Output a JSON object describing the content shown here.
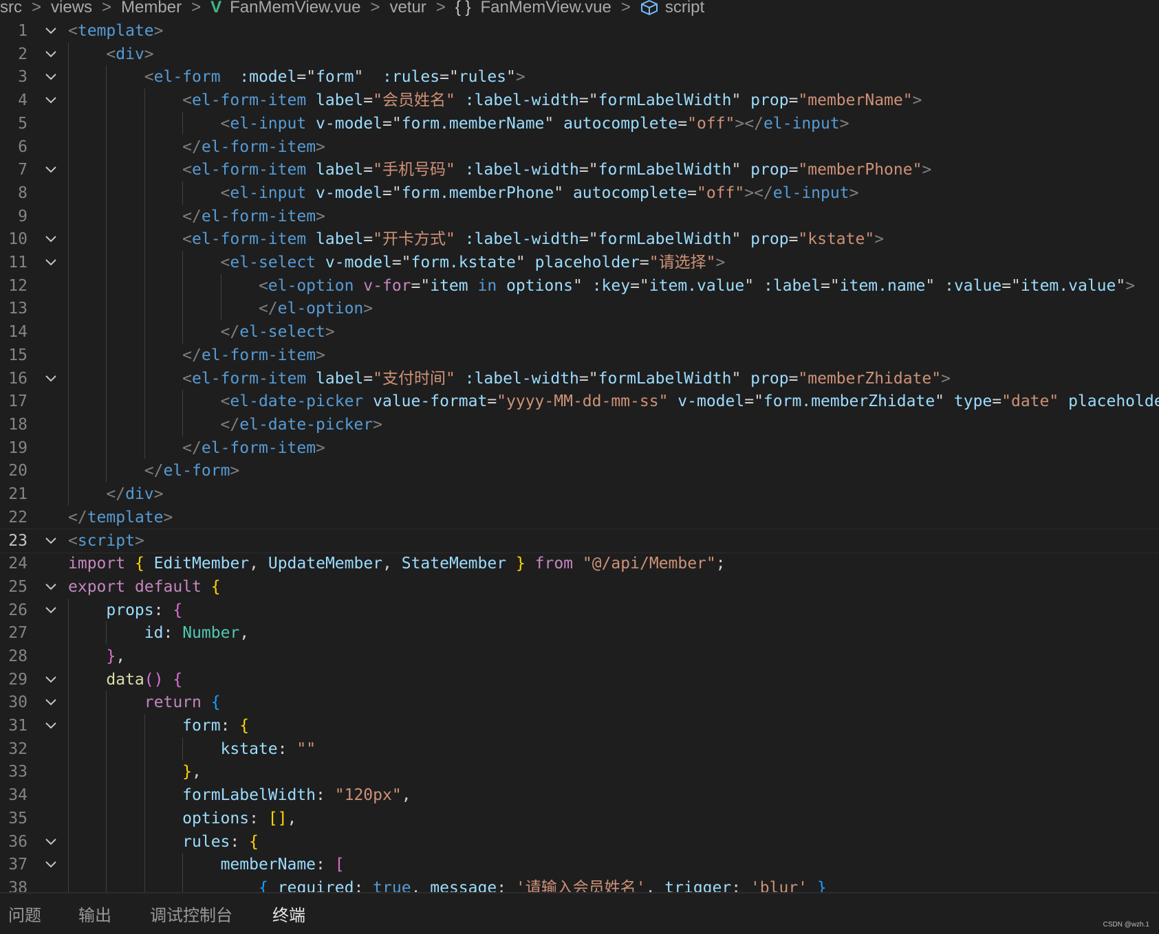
{
  "breadcrumb": {
    "segments": [
      "src",
      "views",
      "Member",
      "FanMemView.vue",
      "vetur",
      "FanMemView.vue",
      "script"
    ],
    "icons": [
      "vue-file-icon",
      "braces-icon",
      "cube-icon"
    ]
  },
  "editor": {
    "colors": {
      "background": "#1e1e1e",
      "tag": "#569cd6",
      "attribute": "#9cdcfe",
      "string": "#ce9178",
      "keyword": "#c586c0"
    },
    "current_line": "23",
    "lines": [
      {
        "n": "1",
        "fold": true
      },
      {
        "n": "2",
        "fold": true
      },
      {
        "n": "3",
        "fold": true
      },
      {
        "n": "4",
        "fold": true
      },
      {
        "n": "5",
        "fold": false
      },
      {
        "n": "6",
        "fold": false
      },
      {
        "n": "7",
        "fold": true
      },
      {
        "n": "8",
        "fold": false
      },
      {
        "n": "9",
        "fold": false
      },
      {
        "n": "10",
        "fold": true
      },
      {
        "n": "11",
        "fold": true
      },
      {
        "n": "12",
        "fold": false
      },
      {
        "n": "13",
        "fold": false
      },
      {
        "n": "14",
        "fold": false
      },
      {
        "n": "15",
        "fold": false
      },
      {
        "n": "16",
        "fold": true
      },
      {
        "n": "17",
        "fold": false
      },
      {
        "n": "18",
        "fold": false
      },
      {
        "n": "19",
        "fold": false
      },
      {
        "n": "20",
        "fold": false
      },
      {
        "n": "21",
        "fold": false
      },
      {
        "n": "22",
        "fold": false
      },
      {
        "n": "23",
        "fold": true
      },
      {
        "n": "24",
        "fold": false
      },
      {
        "n": "25",
        "fold": true
      },
      {
        "n": "26",
        "fold": true
      },
      {
        "n": "27",
        "fold": false
      },
      {
        "n": "28",
        "fold": false
      },
      {
        "n": "29",
        "fold": true
      },
      {
        "n": "30",
        "fold": true
      },
      {
        "n": "31",
        "fold": true
      },
      {
        "n": "32",
        "fold": false
      },
      {
        "n": "33",
        "fold": false
      },
      {
        "n": "34",
        "fold": false
      },
      {
        "n": "35",
        "fold": false
      },
      {
        "n": "36",
        "fold": true
      },
      {
        "n": "37",
        "fold": true
      },
      {
        "n": "38",
        "fold": false
      }
    ],
    "code": [
      [
        [
          "t-br",
          "<"
        ],
        [
          "t-tag",
          "template"
        ],
        [
          "t-br",
          ">"
        ]
      ],
      [
        [
          "t-br",
          "    <"
        ],
        [
          "t-tag",
          "div"
        ],
        [
          "t-br",
          ">"
        ]
      ],
      [
        [
          "t-br",
          "        <"
        ],
        [
          "t-tag",
          "el-form"
        ],
        [
          "",
          "  "
        ],
        [
          "t-attr",
          ":model"
        ],
        [
          "",
          "=\""
        ],
        [
          "t-attr",
          "form"
        ],
        [
          "",
          "\"  "
        ],
        [
          "t-attr",
          ":rules"
        ],
        [
          "",
          "=\""
        ],
        [
          "t-attr",
          "rules"
        ],
        [
          "",
          "\""
        ],
        [
          "t-br",
          ">"
        ]
      ],
      [
        [
          "t-br",
          "            <"
        ],
        [
          "t-tag",
          "el-form-item"
        ],
        [
          "",
          " "
        ],
        [
          "t-attr",
          "label"
        ],
        [
          "",
          "="
        ],
        [
          "t-str",
          "\"会员姓名\""
        ],
        [
          "",
          " "
        ],
        [
          "t-attr",
          ":label-width"
        ],
        [
          "",
          "=\""
        ],
        [
          "t-attr",
          "formLabelWidth"
        ],
        [
          "",
          "\" "
        ],
        [
          "t-attr",
          "prop"
        ],
        [
          "",
          "="
        ],
        [
          "t-str",
          "\"memberName\""
        ],
        [
          "t-br",
          ">"
        ]
      ],
      [
        [
          "t-br",
          "                <"
        ],
        [
          "t-tag",
          "el-input"
        ],
        [
          "",
          " "
        ],
        [
          "t-attr",
          "v-model"
        ],
        [
          "",
          "=\""
        ],
        [
          "t-attr",
          "form.memberName"
        ],
        [
          "",
          "\" "
        ],
        [
          "t-attr",
          "autocomplete"
        ],
        [
          "",
          "="
        ],
        [
          "t-str",
          "\"off\""
        ],
        [
          "t-br",
          "></"
        ],
        [
          "t-tag",
          "el-input"
        ],
        [
          "t-br",
          ">"
        ]
      ],
      [
        [
          "t-br",
          "            </"
        ],
        [
          "t-tag",
          "el-form-item"
        ],
        [
          "t-br",
          ">"
        ]
      ],
      [
        [
          "t-br",
          "            <"
        ],
        [
          "t-tag",
          "el-form-item"
        ],
        [
          "",
          " "
        ],
        [
          "t-attr",
          "label"
        ],
        [
          "",
          "="
        ],
        [
          "t-str",
          "\"手机号码\""
        ],
        [
          "",
          " "
        ],
        [
          "t-attr",
          ":label-width"
        ],
        [
          "",
          "=\""
        ],
        [
          "t-attr",
          "formLabelWidth"
        ],
        [
          "",
          "\" "
        ],
        [
          "t-attr",
          "prop"
        ],
        [
          "",
          "="
        ],
        [
          "t-str",
          "\"memberPhone\""
        ],
        [
          "t-br",
          ">"
        ]
      ],
      [
        [
          "t-br",
          "                <"
        ],
        [
          "t-tag",
          "el-input"
        ],
        [
          "",
          " "
        ],
        [
          "t-attr",
          "v-model"
        ],
        [
          "",
          "=\""
        ],
        [
          "t-attr",
          "form.memberPhone"
        ],
        [
          "",
          "\" "
        ],
        [
          "t-attr",
          "autocomplete"
        ],
        [
          "",
          "="
        ],
        [
          "t-str",
          "\"off\""
        ],
        [
          "t-br",
          "></"
        ],
        [
          "t-tag",
          "el-input"
        ],
        [
          "t-br",
          ">"
        ]
      ],
      [
        [
          "t-br",
          "            </"
        ],
        [
          "t-tag",
          "el-form-item"
        ],
        [
          "t-br",
          ">"
        ]
      ],
      [
        [
          "t-br",
          "            <"
        ],
        [
          "t-tag",
          "el-form-item"
        ],
        [
          "",
          " "
        ],
        [
          "t-attr",
          "label"
        ],
        [
          "",
          "="
        ],
        [
          "t-str",
          "\"开卡方式\""
        ],
        [
          "",
          " "
        ],
        [
          "t-attr",
          ":label-width"
        ],
        [
          "",
          "=\""
        ],
        [
          "t-attr",
          "formLabelWidth"
        ],
        [
          "",
          "\" "
        ],
        [
          "t-attr",
          "prop"
        ],
        [
          "",
          "="
        ],
        [
          "t-str",
          "\"kstate\""
        ],
        [
          "t-br",
          ">"
        ]
      ],
      [
        [
          "t-br",
          "                <"
        ],
        [
          "t-tag",
          "el-select"
        ],
        [
          "",
          " "
        ],
        [
          "t-attr",
          "v-model"
        ],
        [
          "",
          "=\""
        ],
        [
          "t-attr",
          "form.kstate"
        ],
        [
          "",
          "\" "
        ],
        [
          "t-attr",
          "placeholder"
        ],
        [
          "",
          "="
        ],
        [
          "t-str",
          "\"请选择\""
        ],
        [
          "t-br",
          ">"
        ]
      ],
      [
        [
          "t-br",
          "                    <"
        ],
        [
          "t-tag",
          "el-option"
        ],
        [
          "",
          " "
        ],
        [
          "t-kw",
          "v-for"
        ],
        [
          "",
          "=\""
        ],
        [
          "t-attr",
          "item"
        ],
        [
          "",
          " "
        ],
        [
          "t-kw2",
          "in"
        ],
        [
          "",
          " "
        ],
        [
          "t-attr",
          "options"
        ],
        [
          "",
          "\" "
        ],
        [
          "t-attr",
          ":key"
        ],
        [
          "",
          "=\""
        ],
        [
          "t-attr",
          "item.value"
        ],
        [
          "",
          "\" "
        ],
        [
          "t-attr",
          ":label"
        ],
        [
          "",
          "=\""
        ],
        [
          "t-attr",
          "item.name"
        ],
        [
          "",
          "\" "
        ],
        [
          "t-attr",
          ":value"
        ],
        [
          "",
          "=\""
        ],
        [
          "t-attr",
          "item.value"
        ],
        [
          "",
          "\""
        ],
        [
          "t-br",
          ">"
        ]
      ],
      [
        [
          "t-br",
          "                    </"
        ],
        [
          "t-tag",
          "el-option"
        ],
        [
          "t-br",
          ">"
        ]
      ],
      [
        [
          "t-br",
          "                </"
        ],
        [
          "t-tag",
          "el-select"
        ],
        [
          "t-br",
          ">"
        ]
      ],
      [
        [
          "t-br",
          "            </"
        ],
        [
          "t-tag",
          "el-form-item"
        ],
        [
          "t-br",
          ">"
        ]
      ],
      [
        [
          "t-br",
          "            <"
        ],
        [
          "t-tag",
          "el-form-item"
        ],
        [
          "",
          " "
        ],
        [
          "t-attr",
          "label"
        ],
        [
          "",
          "="
        ],
        [
          "t-str",
          "\"支付时间\""
        ],
        [
          "",
          " "
        ],
        [
          "t-attr",
          ":label-width"
        ],
        [
          "",
          "=\""
        ],
        [
          "t-attr",
          "formLabelWidth"
        ],
        [
          "",
          "\" "
        ],
        [
          "t-attr",
          "prop"
        ],
        [
          "",
          "="
        ],
        [
          "t-str",
          "\"memberZhidate\""
        ],
        [
          "t-br",
          ">"
        ]
      ],
      [
        [
          "t-br",
          "                <"
        ],
        [
          "t-tag",
          "el-date-picker"
        ],
        [
          "",
          " "
        ],
        [
          "t-attr",
          "value-format"
        ],
        [
          "",
          "="
        ],
        [
          "t-str",
          "\"yyyy-MM-dd-mm-ss\""
        ],
        [
          "",
          " "
        ],
        [
          "t-attr",
          "v-model"
        ],
        [
          "",
          "=\""
        ],
        [
          "t-attr",
          "form.memberZhidate"
        ],
        [
          "",
          "\" "
        ],
        [
          "t-attr",
          "type"
        ],
        [
          "",
          "="
        ],
        [
          "t-str",
          "\"date\""
        ],
        [
          "",
          " "
        ],
        [
          "t-attr",
          "placeholde"
        ]
      ],
      [
        [
          "t-br",
          "                </"
        ],
        [
          "t-tag",
          "el-date-picker"
        ],
        [
          "t-br",
          ">"
        ]
      ],
      [
        [
          "t-br",
          "            </"
        ],
        [
          "t-tag",
          "el-form-item"
        ],
        [
          "t-br",
          ">"
        ]
      ],
      [
        [
          "t-br",
          "        </"
        ],
        [
          "t-tag",
          "el-form"
        ],
        [
          "t-br",
          ">"
        ]
      ],
      [
        [
          "t-br",
          "    </"
        ],
        [
          "t-tag",
          "div"
        ],
        [
          "t-br",
          ">"
        ]
      ],
      [
        [
          "t-br",
          "</"
        ],
        [
          "t-tag",
          "template"
        ],
        [
          "t-br",
          ">"
        ]
      ],
      [
        [
          "t-br",
          "<"
        ],
        [
          "t-tag",
          "script"
        ],
        [
          "t-br",
          ">"
        ]
      ],
      [
        [
          "t-kw",
          "import"
        ],
        [
          "",
          " "
        ],
        [
          "t-y",
          "{"
        ],
        [
          "",
          " "
        ],
        [
          "t-attr",
          "EditMember"
        ],
        [
          "",
          ", "
        ],
        [
          "t-attr",
          "UpdateMember"
        ],
        [
          "",
          ", "
        ],
        [
          "t-attr",
          "StateMember"
        ],
        [
          "",
          " "
        ],
        [
          "t-y",
          "}"
        ],
        [
          "",
          " "
        ],
        [
          "t-kw",
          "from"
        ],
        [
          "",
          " "
        ],
        [
          "t-str",
          "\"@/api/Member\""
        ],
        [
          "",
          ";"
        ]
      ],
      [
        [
          "t-kw",
          "export"
        ],
        [
          "",
          " "
        ],
        [
          "t-kw",
          "default"
        ],
        [
          "",
          " "
        ],
        [
          "t-y",
          "{"
        ]
      ],
      [
        [
          "",
          "    "
        ],
        [
          "t-attr",
          "props"
        ],
        [
          "",
          ": "
        ],
        [
          "t-p",
          "{"
        ]
      ],
      [
        [
          "",
          "        "
        ],
        [
          "t-attr",
          "id"
        ],
        [
          "",
          ": "
        ],
        [
          "t-type",
          "Number"
        ],
        [
          "",
          ","
        ]
      ],
      [
        [
          "",
          "    "
        ],
        [
          "t-p",
          "}"
        ],
        [
          "",
          ","
        ]
      ],
      [
        [
          "",
          "    "
        ],
        [
          "t-fn",
          "data"
        ],
        [
          "t-p",
          "()"
        ],
        [
          "",
          " "
        ],
        [
          "t-p",
          "{"
        ]
      ],
      [
        [
          "",
          "        "
        ],
        [
          "t-kw",
          "return"
        ],
        [
          "",
          " "
        ],
        [
          "t-b",
          "{"
        ]
      ],
      [
        [
          "",
          "            "
        ],
        [
          "t-attr",
          "form"
        ],
        [
          "",
          ": "
        ],
        [
          "t-y",
          "{"
        ]
      ],
      [
        [
          "",
          "                "
        ],
        [
          "t-attr",
          "kstate"
        ],
        [
          "",
          ": "
        ],
        [
          "t-str",
          "\"\""
        ]
      ],
      [
        [
          "",
          "            "
        ],
        [
          "t-y",
          "}"
        ],
        [
          "",
          ","
        ]
      ],
      [
        [
          "",
          "            "
        ],
        [
          "t-attr",
          "formLabelWidth"
        ],
        [
          "",
          ": "
        ],
        [
          "t-str",
          "\"120px\""
        ],
        [
          "",
          ","
        ]
      ],
      [
        [
          "",
          "            "
        ],
        [
          "t-attr",
          "options"
        ],
        [
          "",
          ": "
        ],
        [
          "t-y",
          "[]"
        ],
        [
          "",
          ","
        ]
      ],
      [
        [
          "",
          "            "
        ],
        [
          "t-attr",
          "rules"
        ],
        [
          "",
          ": "
        ],
        [
          "t-y",
          "{"
        ]
      ],
      [
        [
          "",
          "                "
        ],
        [
          "t-attr",
          "memberName"
        ],
        [
          "",
          ": "
        ],
        [
          "t-p",
          "["
        ]
      ],
      [
        [
          "",
          "                    "
        ],
        [
          "t-b",
          "{"
        ],
        [
          "",
          " "
        ],
        [
          "t-attr",
          "required"
        ],
        [
          "",
          ": "
        ],
        [
          "t-kw2",
          "true"
        ],
        [
          "",
          ", "
        ],
        [
          "t-attr",
          "message"
        ],
        [
          "",
          ": "
        ],
        [
          "t-str",
          "'请输入会员姓名'"
        ],
        [
          "",
          ", "
        ],
        [
          "t-attr",
          "trigger"
        ],
        [
          "",
          ": "
        ],
        [
          "t-str",
          "'blur'"
        ],
        [
          "",
          " "
        ],
        [
          "t-b",
          "}"
        ]
      ]
    ]
  },
  "panel": {
    "tabs": [
      "问题",
      "输出",
      "调试控制台",
      "终端"
    ],
    "active_tab": "终端"
  },
  "watermark": "CSDN @wzh.1"
}
